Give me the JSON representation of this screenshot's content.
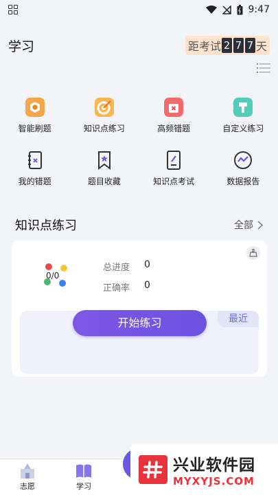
{
  "status": {
    "time": "9:47"
  },
  "header": {
    "title": "学习",
    "exam_prefix": "距考试",
    "exam_digits": [
      "2",
      "7",
      "7"
    ],
    "exam_suffix": "天"
  },
  "features": [
    {
      "label": "智能刷题",
      "icon": "smart-practice-icon"
    },
    {
      "label": "知识点练习",
      "icon": "knowledge-target-icon"
    },
    {
      "label": "高频错题",
      "icon": "frequent-mistakes-icon"
    },
    {
      "label": "自定义练习",
      "icon": "custom-practice-icon"
    },
    {
      "label": "我的错题",
      "icon": "my-mistakes-icon"
    },
    {
      "label": "题目收藏",
      "icon": "bookmark-icon"
    },
    {
      "label": "知识点考试",
      "icon": "exam-paper-icon"
    },
    {
      "label": "数据报告",
      "icon": "data-report-icon"
    }
  ],
  "section": {
    "title": "知识点练习",
    "more_label": "全部"
  },
  "card": {
    "progress_fraction": "0/0",
    "total_progress_label": "总进度",
    "total_progress_value": "0",
    "accuracy_label": "正确率",
    "accuracy_value": "0",
    "start_button": "开始练习",
    "recent_tag": "最近"
  },
  "tabbar": {
    "items": [
      {
        "label": "志愿",
        "icon": "castle-icon"
      },
      {
        "label": "学习",
        "icon": "book-icon"
      }
    ]
  },
  "watermark": {
    "logo_char": "#",
    "cn": "兴业软件园",
    "en": "MYXYJS.COM"
  },
  "colors": {
    "accent": "#6c52e0",
    "exam_bg": "#ffe3cf",
    "watermark_red": "#e8323c"
  }
}
